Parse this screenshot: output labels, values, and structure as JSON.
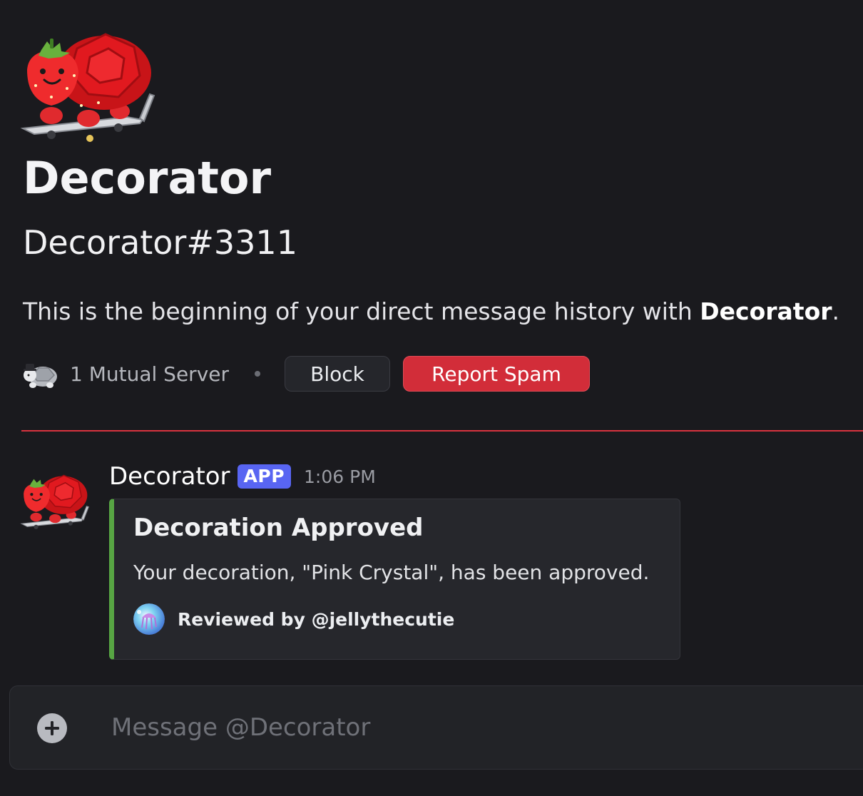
{
  "profile": {
    "display_name": "Decorator",
    "username": "Decorator#3311",
    "intro_prefix": "This is the beginning of your direct message history with ",
    "intro_name": "Decorator",
    "intro_suffix": ".",
    "mutual_servers": "1 Mutual Server",
    "block_label": "Block",
    "report_label": "Report Spam"
  },
  "message": {
    "author": "Decorator",
    "badge": "APP",
    "time": "1:06 PM",
    "embed": {
      "accent_color": "#57a543",
      "title": "Decoration Approved",
      "description": "Your decoration, \"Pink Crystal\", has been approved.",
      "footer": "Reviewed by @jellythecutie"
    }
  },
  "composer": {
    "placeholder": "Message @Decorator"
  },
  "colors": {
    "background": "#1a1a1e",
    "danger": "#d22d39",
    "badge": "#5865f2",
    "new_divider": "#d9333f"
  }
}
